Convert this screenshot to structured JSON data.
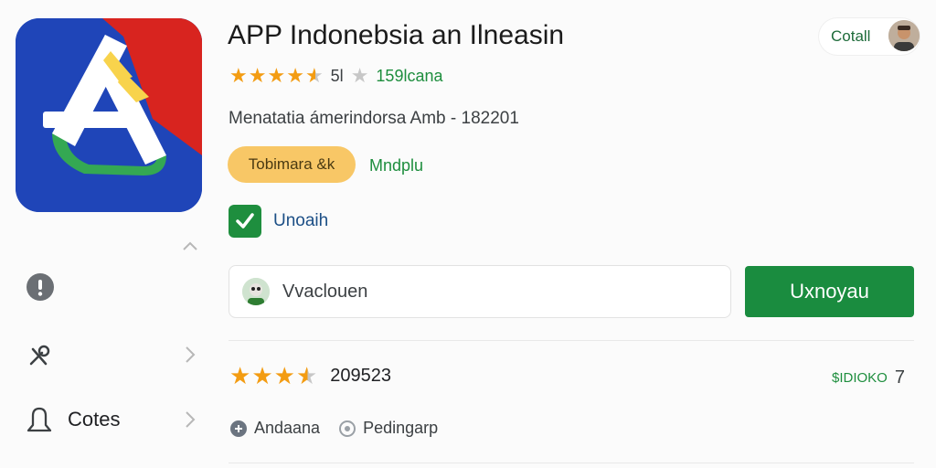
{
  "app": {
    "title": "APP Indonebsia an Ilneasin",
    "rating_value": "5l",
    "review_link": "159lcana",
    "subtitle": "Menatatia ámerindorsa Amb - 182201",
    "tag_label": "Tobimara &k",
    "tag_link": "Mndplu",
    "check_label": "Unoaih",
    "rating_stars": 4.5
  },
  "install": {
    "account_text": "Vvaclouen",
    "button_label": "Uxnoyau"
  },
  "reviews": {
    "rating_stars": 3.5,
    "count": "209523",
    "right_link": "$IDIOKO",
    "right_chevron": "7"
  },
  "info": {
    "item1": "Andaana",
    "item2": "Pedingarp"
  },
  "sidebar": {
    "items": [
      {
        "icon": "info-icon"
      },
      {
        "icon": "tools-icon"
      },
      {
        "icon": "bell-icon",
        "label": "Cotes"
      }
    ]
  },
  "top_right": {
    "detail_label": "Cotall"
  },
  "colors": {
    "accent_green": "#1a8c3f",
    "star_orange": "#f39c12",
    "tag_yellow": "#f8c766"
  }
}
